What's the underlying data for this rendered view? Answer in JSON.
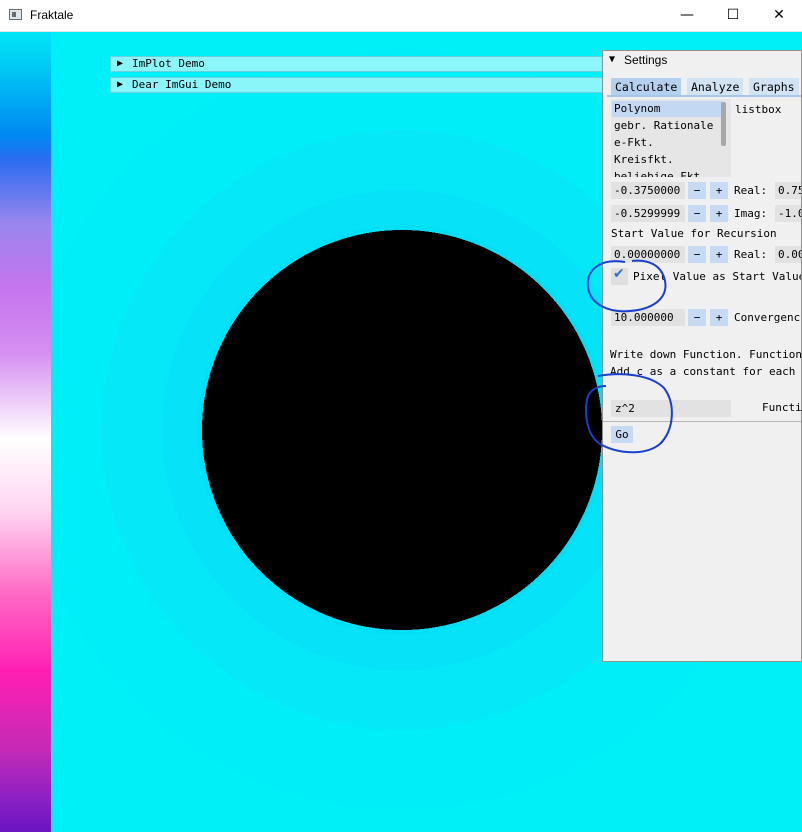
{
  "window": {
    "title": "Fraktale",
    "minimize_glyph": "—",
    "maximize_glyph": "☐",
    "close_glyph": "✕"
  },
  "collapsers": [
    {
      "label": "ImPlot Demo",
      "arrow": "▶"
    },
    {
      "label": "Dear ImGui Demo",
      "arrow": "▶"
    }
  ],
  "settings": {
    "title": "Settings",
    "arrow": "▼",
    "tabs": [
      "Calculate",
      "Analyze",
      "Graphs"
    ],
    "active_tab": "Calculate",
    "listbox": {
      "label": "listbox",
      "items": [
        "Polynom",
        "gebr. Rationale",
        "e-Fkt.",
        "Kreisfkt.",
        "beliebige Fkt."
      ],
      "selected": "Polynom"
    },
    "rows": [
      {
        "value": "-0.3750000",
        "label": "Real:",
        "right_value": "0.75"
      },
      {
        "value": "-0.5299999",
        "label": "Imag:",
        "right_value": "-1.0"
      }
    ],
    "start_value_heading": "Start Value for Recursion",
    "start_row": {
      "value": "0.00000000",
      "label": "Real:",
      "right_value": "0.00"
    },
    "pixel_value_checkbox": {
      "label": "Pixel Value as Start Value",
      "checked": true
    },
    "convergence": {
      "value": "10.000000",
      "label": "Convergence"
    },
    "minus_label": "−",
    "plus_label": "+",
    "function_help_1": "Write down Function. Function",
    "function_help_2": "Add c as a constant for each",
    "function": {
      "value": "z^2",
      "label": "Function"
    },
    "go_label": "Go"
  },
  "colors": {
    "fractal_bg": "#00eef8",
    "set_interior": "#000000",
    "annotation_ink": "#1a3fcf"
  }
}
